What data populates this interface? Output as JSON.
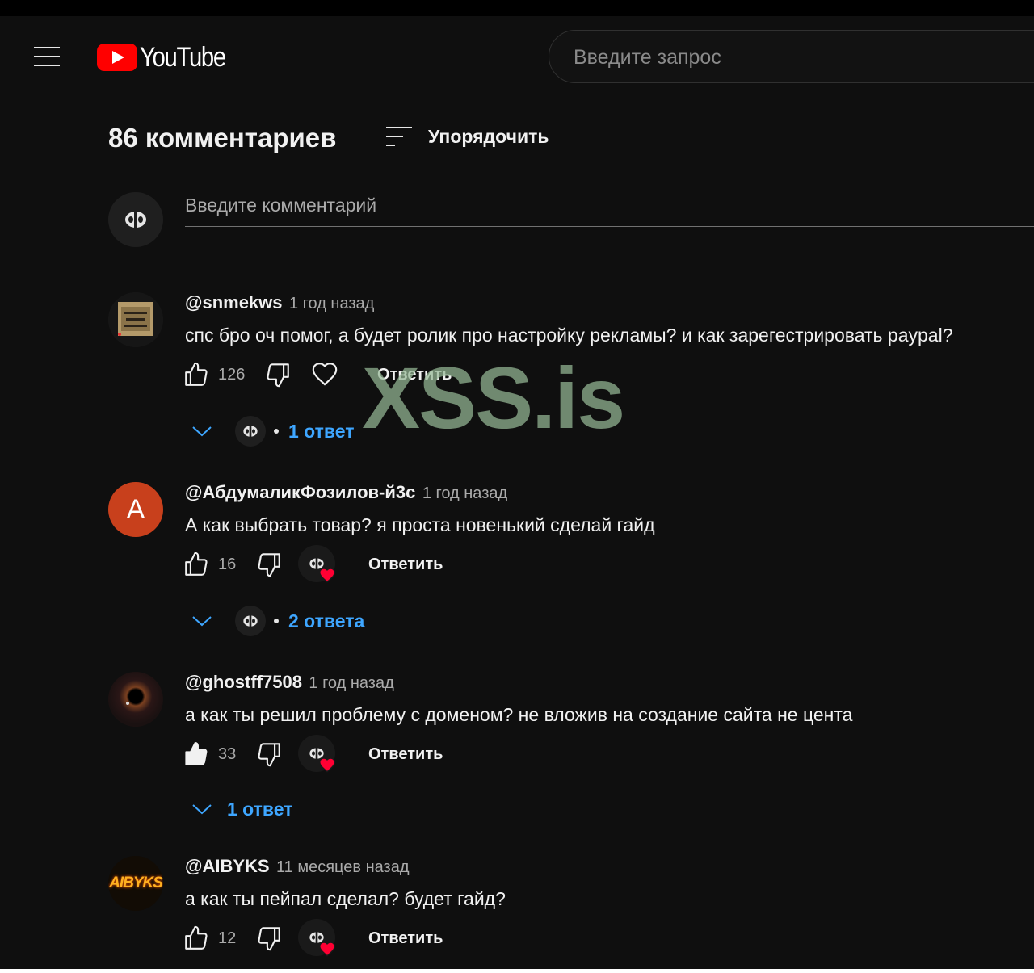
{
  "header": {
    "logo_text": "YouTube",
    "search_placeholder": "Введите запрос"
  },
  "comments_header": {
    "count_label": "86 комментариев",
    "sort_label": "Упорядочить"
  },
  "add_comment": {
    "placeholder": "Введите комментарий"
  },
  "comments": [
    {
      "author": "@snmekws",
      "time": "1 год назад",
      "text": "спс бро оч помог, а будет ролик про настройку рекламы? и как зарегестрировать paypal?",
      "likes": "126",
      "reply_label": "Ответить",
      "replies_label": "1 ответ",
      "liked": false
    },
    {
      "author": "@АбдумаликФозилов-й3с",
      "time": "1 год назад",
      "text": "А как выбрать товар? я проста новенький сделай гайд",
      "likes": "16",
      "reply_label": "Ответить",
      "replies_label": "2 ответа",
      "avatar_letter": "А",
      "liked": false
    },
    {
      "author": "@ghostff7508",
      "time": "1 год назад",
      "text": "а как ты решил проблему с доменом? не вложив на создание сайта не цента",
      "likes": "33",
      "reply_label": "Ответить",
      "replies_label": "1 ответ",
      "liked": true
    },
    {
      "author": "@AIBYKS",
      "time": "11 месяцев назад",
      "text": "а как ты пейпал сделал? будет гайд?",
      "likes": "12",
      "reply_label": "Ответить",
      "avatar_text": "AIBYKS",
      "liked": false
    }
  ],
  "watermark": "XSS.is",
  "colors": {
    "background": "#0f0f0f",
    "link_blue": "#3ea6ff",
    "brand_red": "#ff0000",
    "avatar_orange": "#c8401c"
  }
}
